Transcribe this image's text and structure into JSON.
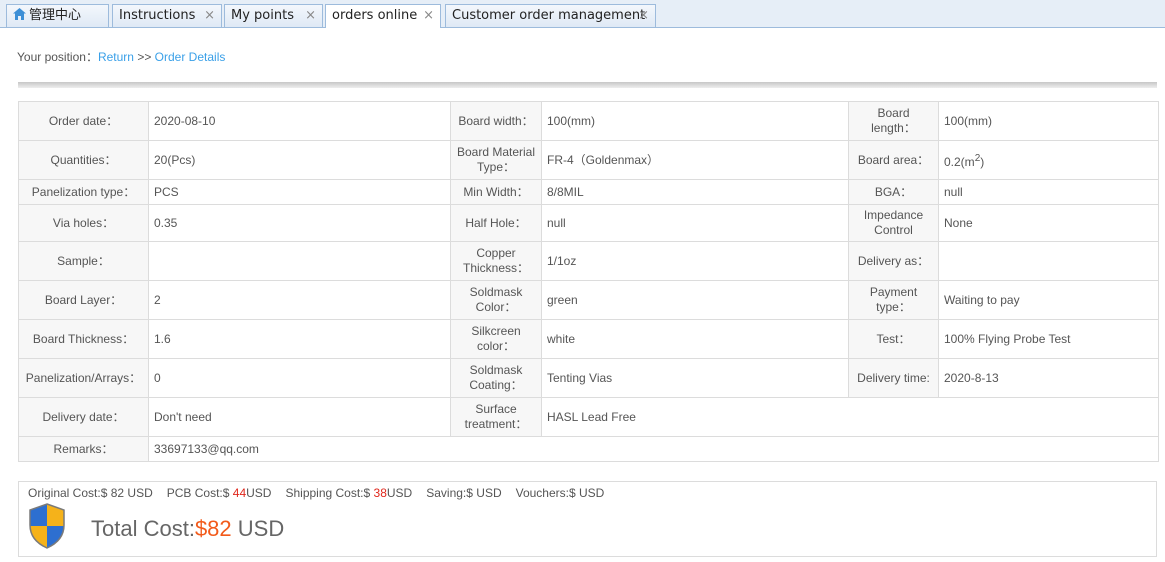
{
  "tabs": [
    {
      "label": "管理中心",
      "icon": "home-icon",
      "closable": false
    },
    {
      "label": "Instructions",
      "closable": true
    },
    {
      "label": "My points",
      "closable": true
    },
    {
      "label": "orders online",
      "closable": true,
      "active": true
    },
    {
      "label": "Customer order management",
      "closable": true
    }
  ],
  "close_glyph": "×",
  "breadcrumb": {
    "prefix": "Your position：",
    "return_label": "Return",
    "separator": " >> ",
    "current": "Order Details"
  },
  "details": {
    "order_date": {
      "label": "Order date：",
      "value": "2020-08-10"
    },
    "board_width": {
      "label": "Board width：",
      "value": "100(mm)"
    },
    "board_length": {
      "label": "Board length：",
      "value": "100(mm)"
    },
    "quantities": {
      "label": "Quantities：",
      "value": "20(Pcs)"
    },
    "board_material": {
      "label": "Board Material Type：",
      "value": "FR-4（Goldenmax）"
    },
    "board_area": {
      "label": "Board area：",
      "value": "0.2(m",
      "sup": "2",
      "suffix": ")"
    },
    "panelization_type": {
      "label": "Panelization type：",
      "value": "PCS"
    },
    "min_width": {
      "label": "Min Width：",
      "value": "8/8MIL"
    },
    "bga": {
      "label": "BGA：",
      "value": "null"
    },
    "via_holes": {
      "label": "Via holes：",
      "value": "0.35"
    },
    "half_hole": {
      "label": "Half Hole：",
      "value": "null"
    },
    "impedance": {
      "label": "Impedance Control",
      "value": "None"
    },
    "sample": {
      "label": "Sample：",
      "value": ""
    },
    "copper": {
      "label": "Copper Thickness：",
      "value": "1/1oz"
    },
    "delivery_as": {
      "label": "Delivery as：",
      "value": ""
    },
    "board_layer": {
      "label": "Board Layer：",
      "value": "2"
    },
    "soldmask_color": {
      "label": "Soldmask Color：",
      "value": "green"
    },
    "payment_type": {
      "label": "Payment type：",
      "value": "Waiting to pay"
    },
    "board_thickness": {
      "label": "Board Thickness：",
      "value": "1.6"
    },
    "silkcreen": {
      "label": "Silkcreen color：",
      "value": "white"
    },
    "test": {
      "label": "Test：",
      "value": "100% Flying Probe Test"
    },
    "panelization_arrays": {
      "label": "Panelization/Arrays：",
      "value": "0"
    },
    "soldmask_coating": {
      "label": "Soldmask Coating：",
      "value": "Tenting Vias"
    },
    "delivery_time": {
      "label": "Delivery time:",
      "value": "2020-8-13"
    },
    "delivery_date": {
      "label": "Delivery date：",
      "value": "Don't need"
    },
    "surface": {
      "label": "Surface treatment：",
      "value": "HASL Lead Free"
    },
    "remarks": {
      "label": "Remarks：",
      "value": "33697133@qq.com"
    }
  },
  "costs": {
    "original_label": "Original Cost:$",
    "original_value": " 82",
    "original_unit": " USD",
    "pcb_label": "PCB Cost:$",
    "pcb_value": " 44",
    "pcb_unit": "USD",
    "shipping_label": "Shipping Cost:$",
    "shipping_value": " 38",
    "shipping_unit": "USD",
    "saving_label": "Saving:$",
    "saving_unit": " USD",
    "vouchers_label": "Vouchers:$",
    "vouchers_unit": " USD"
  },
  "total": {
    "label": "Total Cost:",
    "amount": "$82",
    "unit": " USD"
  },
  "colors": {
    "link": "#3aa0e8",
    "red": "#e0261b",
    "total_amount": "#f25a1a"
  }
}
